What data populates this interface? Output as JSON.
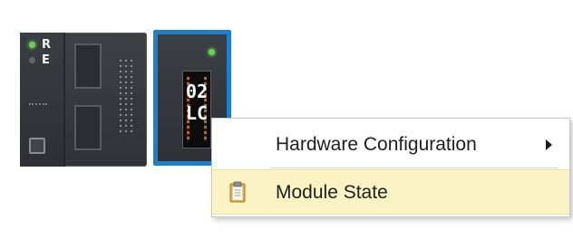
{
  "hardware": {
    "cpu": {
      "led_run_label": "R",
      "led_error_label": "E"
    },
    "lc_module": {
      "number": "02",
      "type_code": "LC",
      "selected": true
    }
  },
  "context_menu": {
    "items": [
      {
        "label": "Hardware Configuration",
        "has_submenu": true,
        "icon": "none"
      },
      {
        "label": "Module State",
        "has_submenu": false,
        "icon": "clipboard-icon",
        "highlighted": true
      }
    ]
  },
  "colors": {
    "selection_border": "#1f7fcf",
    "menu_highlight": "#fbf3c4",
    "led_green": "#69d34e"
  }
}
